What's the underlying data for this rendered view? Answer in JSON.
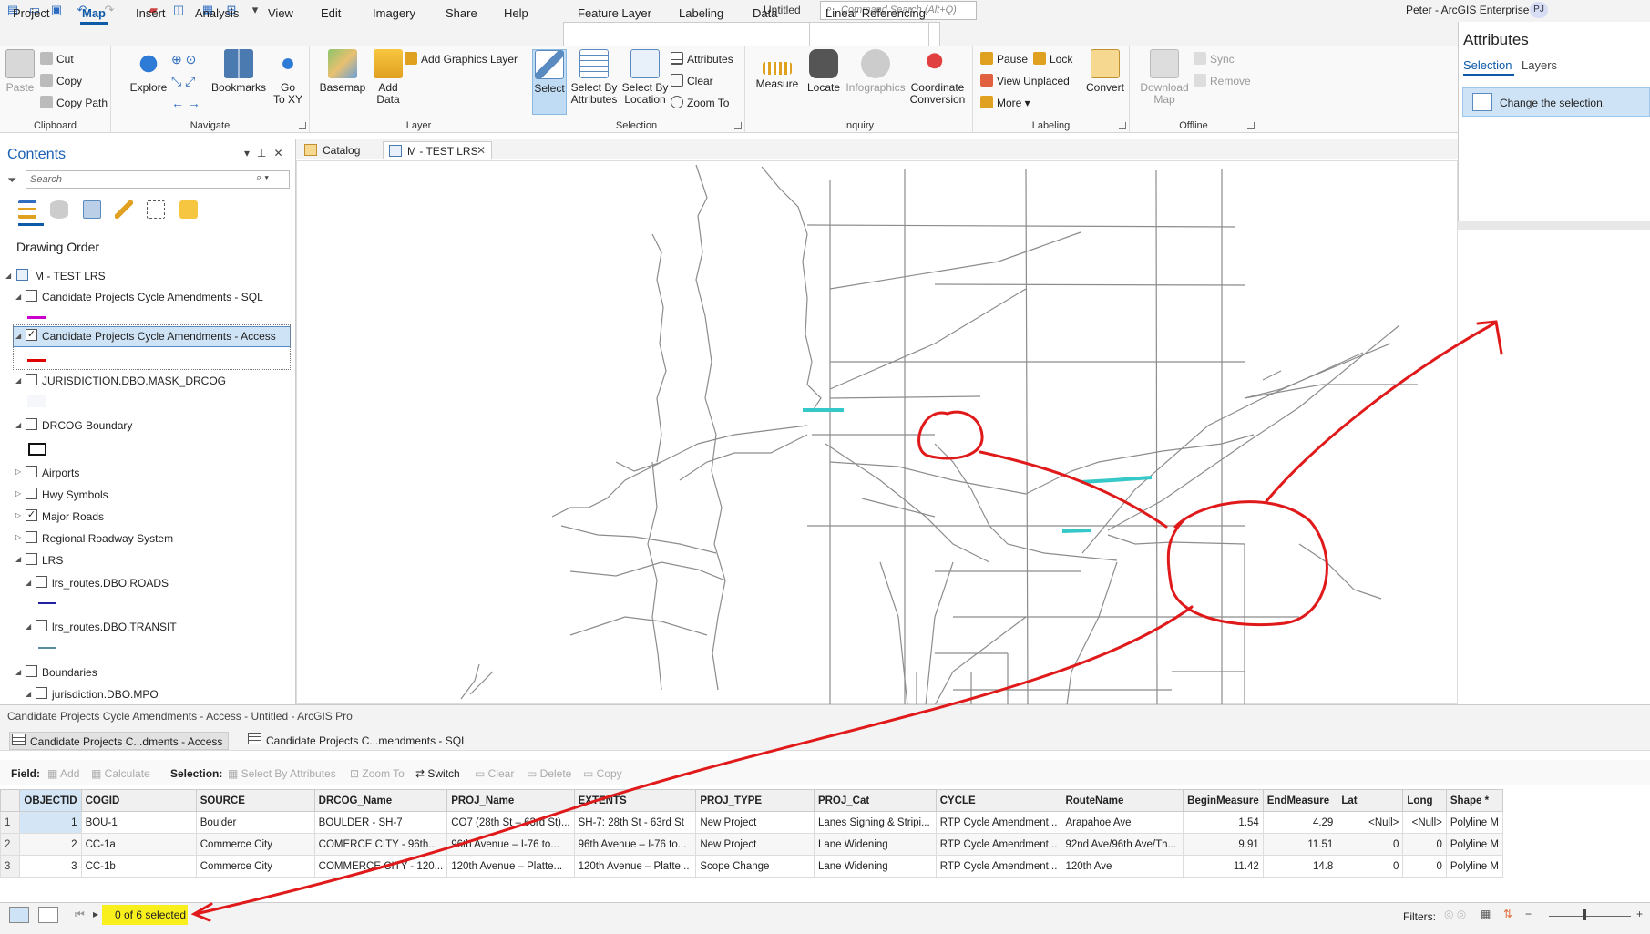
{
  "window": {
    "title": "Untitled",
    "command_search_placeholder": "Command Search (Alt+Q)",
    "user": "Peter - ArcGIS Enterprise",
    "user_initials": "PJ"
  },
  "menu": {
    "tabs": [
      "Project",
      "Map",
      "Insert",
      "Analysis",
      "View",
      "Edit",
      "Imagery",
      "Share",
      "Help",
      "Feature Layer",
      "Labeling",
      "Data",
      "Linear Referencing"
    ],
    "active": "Map"
  },
  "ribbon": {
    "clipboard": {
      "label": "Clipboard",
      "paste": "Paste",
      "cut": "Cut",
      "copy": "Copy",
      "copy_path": "Copy Path"
    },
    "navigate": {
      "label": "Navigate",
      "explore": "Explore",
      "bookmarks": "Bookmarks",
      "go_to_xy": "Go\nTo XY"
    },
    "layer": {
      "label": "Layer",
      "basemap": "Basemap",
      "add_data": "Add\nData",
      "add_graphics_layer": "Add Graphics Layer"
    },
    "selection": {
      "label": "Selection",
      "select": "Select",
      "select_by_attributes": "Select By\nAttributes",
      "select_by_location": "Select By\nLocation",
      "attributes": "Attributes",
      "clear": "Clear",
      "zoom_to": "Zoom To"
    },
    "inquiry": {
      "label": "Inquiry",
      "measure": "Measure",
      "locate": "Locate",
      "infographics": "Infographics",
      "coordinate_conversion": "Coordinate\nConversion"
    },
    "labeling": {
      "label": "Labeling",
      "pause": "Pause",
      "lock": "Lock",
      "view_unplaced": "View Unplaced",
      "more": "More",
      "convert": "Convert"
    },
    "offline": {
      "label": "Offline",
      "download_map": "Download\nMap",
      "sync": "Sync",
      "remove": "Remove"
    }
  },
  "attributes_pane": {
    "title": "Attributes",
    "tabs": [
      "Selection",
      "Layers"
    ],
    "change_selection": "Change the selection."
  },
  "contents": {
    "title": "Contents",
    "search_placeholder": "Search",
    "drawing_order": "Drawing Order",
    "layers": [
      {
        "name": "M - TEST LRS"
      },
      {
        "name": "Candidate Projects Cycle Amendments - SQL",
        "checked": false,
        "symbol": "#cc00cc"
      },
      {
        "name": "Candidate Projects Cycle Amendments - Access",
        "checked": true,
        "symbol": "#e00000"
      },
      {
        "name": "JURISDICTION.DBO.MASK_DRCOG",
        "checked": false
      },
      {
        "name": "DRCOG Boundary",
        "checked": false
      },
      {
        "name": "Airports",
        "checked": false
      },
      {
        "name": "Hwy Symbols",
        "checked": false
      },
      {
        "name": "Major Roads",
        "checked": true
      },
      {
        "name": "Regional Roadway System",
        "checked": false
      },
      {
        "name": "LRS",
        "checked": false
      },
      {
        "name": "lrs_routes.DBO.ROADS",
        "checked": false,
        "symbol": "#2020a0"
      },
      {
        "name": "lrs_routes.DBO.TRANSIT",
        "checked": false,
        "symbol": "#5a8aa0"
      },
      {
        "name": "Boundaries",
        "checked": false
      },
      {
        "name": "jurisdiction.DBO.MPO",
        "checked": false
      }
    ]
  },
  "view_tabs": {
    "catalog": "Catalog",
    "map": "M - TEST LRS"
  },
  "status_title": "Candidate Projects Cycle Amendments - Access - Untitled - ArcGIS Pro",
  "table_tabs": [
    "Candidate Projects C...dments - Access",
    "Candidate Projects C...mendments - SQL"
  ],
  "table_toolbar": {
    "field": "Field:",
    "add": "Add",
    "calculate": "Calculate",
    "selection": "Selection:",
    "select_by_attributes": "Select By Attributes",
    "zoom_to": "Zoom To",
    "switch": "Switch",
    "clear": "Clear",
    "delete": "Delete",
    "copy": "Copy"
  },
  "table": {
    "columns": [
      "OBJECTID",
      "COGID",
      "SOURCE",
      "DRCOG_Name",
      "PROJ_Name",
      "EXTENTS",
      "PROJ_TYPE",
      "PROJ_Cat",
      "CYCLE",
      "RouteName",
      "BeginMeasure",
      "EndMeasure",
      "Lat",
      "Long",
      "Shape *"
    ],
    "rows": [
      [
        "1",
        "1",
        "BOU-1",
        "Boulder",
        "BOULDER - SH-7",
        "CO7 (28th St – 63rd St)...",
        "SH-7: 28th St - 63rd St",
        "New Project",
        "Lanes Signing & Stripi...",
        "RTP Cycle Amendment...",
        "Arapahoe Ave",
        "1.54",
        "4.29",
        "<Null>",
        "<Null>",
        "Polyline M"
      ],
      [
        "2",
        "2",
        "CC-1a",
        "Commerce City",
        "COMERCE CITY - 96th...",
        "96th Avenue – I-76 to...",
        "96th Avenue – I-76 to...",
        "New Project",
        "Lane Widening",
        "RTP Cycle Amendment...",
        "92nd Ave/96th Ave/Th...",
        "9.91",
        "11.51",
        "0",
        "0",
        "Polyline M"
      ],
      [
        "3",
        "3",
        "CC-1b",
        "Commerce City",
        "COMMERCE CITY - 120...",
        "120th Avenue – Platte...",
        "120th Avenue – Platte...",
        "Scope Change",
        "Lane Widening",
        "RTP Cycle Amendment...",
        "120th Ave",
        "11.42",
        "14.8",
        "0",
        "0",
        "Polyline M"
      ]
    ]
  },
  "footer": {
    "selected": "0 of 6 selected",
    "filters": "Filters:"
  }
}
